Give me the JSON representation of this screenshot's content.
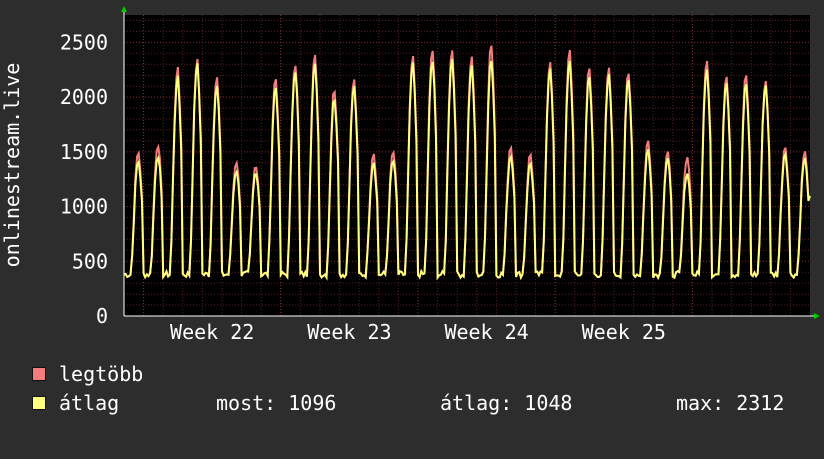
{
  "colors": {
    "background": "#2d2d2d",
    "plot_background": "#000000",
    "grid": "#5a1e1e",
    "axis": "#ffffff",
    "text": "#ffffff",
    "arrow": "#00cc00",
    "max_series": "#f47c7c",
    "avg_series": "#ffff80"
  },
  "chart_data": {
    "type": "line",
    "ylabel": "onlinestream.live",
    "y_ticks": [
      "0",
      "500",
      "1000",
      "1500",
      "2000",
      "2500"
    ],
    "ylim": [
      0,
      2750
    ],
    "x_ticks": [
      "Week 22",
      "Week 23",
      "Week 24",
      "Week 25"
    ],
    "grid": true,
    "legend_position": "bottom-left",
    "days": 35,
    "series": [
      {
        "name": "legtöbb",
        "daily_peaks": [
          1500,
          1580,
          2260,
          2340,
          2200,
          1420,
          1390,
          2180,
          2320,
          2380,
          2080,
          2160,
          1500,
          1500,
          2360,
          2440,
          2440,
          2360,
          2500,
          1560,
          1480,
          2320,
          2440,
          2260,
          2260,
          2220,
          1600,
          1500,
          1470,
          2360,
          2220,
          2200,
          2160,
          1560,
          1500
        ]
      },
      {
        "name": "átlag",
        "daily_peaks": [
          1420,
          1480,
          2180,
          2300,
          2120,
          1340,
          1330,
          2100,
          2260,
          2300,
          2000,
          2100,
          1420,
          1420,
          2300,
          2340,
          2360,
          2280,
          2360,
          1480,
          1400,
          2260,
          2340,
          2180,
          2200,
          2160,
          1520,
          1440,
          1320,
          2280,
          2160,
          2120,
          2120,
          1500,
          1440
        ]
      }
    ]
  },
  "legend": {
    "max_label": "legtöbb",
    "avg_label": "átlag"
  },
  "stats": {
    "current": "most: 1096",
    "average": "átlag: 1048",
    "maximum": "max: 2312"
  }
}
